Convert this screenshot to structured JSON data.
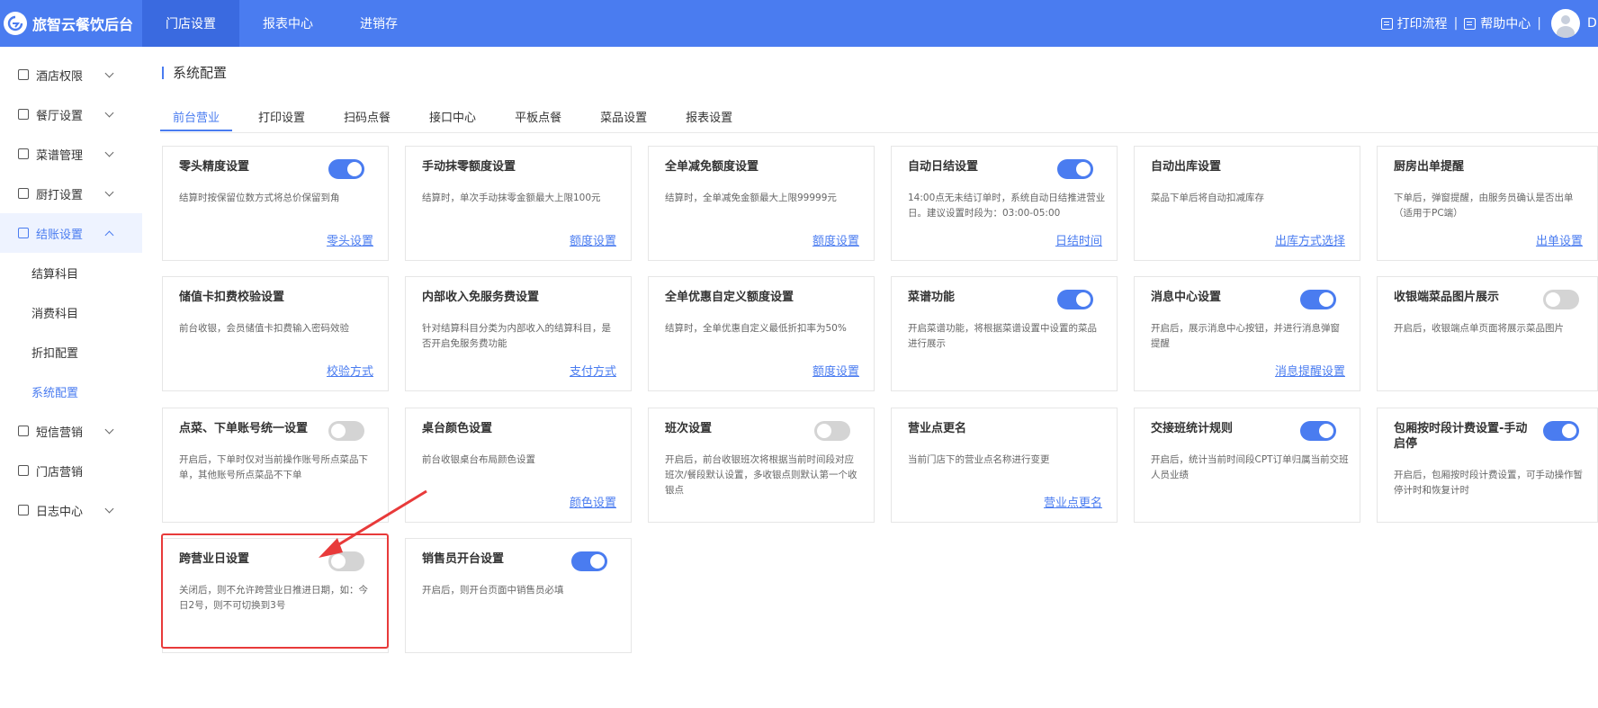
{
  "brand": {
    "title": "旅智云餐饮后台"
  },
  "topnav": [
    "门店设置",
    "报表中心",
    "进销存"
  ],
  "topright": {
    "print_flow": "打印流程",
    "help_center": "帮助中心",
    "separator": "|",
    "user_initial": "D"
  },
  "sidebar": {
    "items": [
      {
        "label": "酒店权限"
      },
      {
        "label": "餐厅设置"
      },
      {
        "label": "菜谱管理"
      },
      {
        "label": "厨打设置"
      },
      {
        "label": "结账设置"
      },
      {
        "label": "短信营销"
      },
      {
        "label": "门店营销"
      },
      {
        "label": "日志中心"
      }
    ],
    "sub_items": [
      "结算科目",
      "消费科目",
      "折扣配置",
      "系统配置"
    ]
  },
  "page": {
    "title": "系统配置"
  },
  "tabs": [
    "前台营业",
    "打印设置",
    "扫码点餐",
    "接口中心",
    "平板点餐",
    "菜品设置",
    "报表设置"
  ],
  "cards": [
    {
      "title": "零头精度设置",
      "desc": "结算时按保留位数方式将总价保留到角",
      "link": "零头设置",
      "toggle": "on"
    },
    {
      "title": "手动抹零额度设置",
      "desc": "结算时，单次手动抹零金额最大上限100元",
      "link": "额度设置"
    },
    {
      "title": "全单减免额度设置",
      "desc": "结算时，全单减免金额最大上限99999元",
      "link": "额度设置"
    },
    {
      "title": "自动日结设置",
      "desc": "14:00点无未结订单时，系统自动日结推进营业日。建议设置时段为：03:00-05:00",
      "link": "日结时间",
      "toggle": "on"
    },
    {
      "title": "自动出库设置",
      "desc": "菜品下单后将自动扣减库存",
      "link": "出库方式选择"
    },
    {
      "title": "厨房出单提醒",
      "desc": "下单后，弹窗提醒，由服务员确认是否出单（适用于PC端）",
      "link": "出单设置"
    },
    {
      "title": "储值卡扣费校验设置",
      "desc": "前台收银，会员储值卡扣费输入密码效验",
      "link": "校验方式"
    },
    {
      "title": "内部收入免服务费设置",
      "desc": "针对结算科目分类为内部收入的结算科目，是否开启免服务费功能",
      "link": "支付方式"
    },
    {
      "title": "全单优惠自定义额度设置",
      "desc": "结算时，全单优惠自定义最低折扣率为50%",
      "link": "额度设置"
    },
    {
      "title": "菜谱功能",
      "desc": "开启菜谱功能，将根据菜谱设置中设置的菜品进行展示",
      "link": "",
      "toggle": "on"
    },
    {
      "title": "消息中心设置",
      "desc": "开启后，展示消息中心按钮，并进行消息弹窗提醒",
      "link": "消息提醒设置",
      "toggle": "on"
    },
    {
      "title": "收银端菜品图片展示",
      "desc": "开启后，收银端点单页面将展示菜品图片",
      "link": "",
      "toggle": "off"
    },
    {
      "title": "点菜、下单账号统一设置",
      "desc": "开启后，下单时仅对当前操作账号所点菜品下单，其他账号所点菜品不下单",
      "link": "",
      "toggle": "off"
    },
    {
      "title": "桌台颜色设置",
      "desc": "前台收银桌台布局颜色设置",
      "link": "颜色设置"
    },
    {
      "title": "班次设置",
      "desc": "开启后，前台收银班次将根据当前时间段对应班次/餐段默认设置，多收银点则默认第一个收银点",
      "link": "",
      "toggle": "off"
    },
    {
      "title": "营业点更名",
      "desc": "当前门店下的营业点名称进行变更",
      "link": "营业点更名"
    },
    {
      "title": "交接班统计规则",
      "desc": "开启后，统计当前时间段CPT订单归属当前交班人员业绩",
      "link": "",
      "toggle": "on"
    },
    {
      "title": "包厢按时段计费设置-手动启停",
      "desc": "开启后，包厢按时段计费设置，可手动操作暂停计时和恢复计时",
      "link": "",
      "toggle": "on"
    },
    {
      "title": "跨营业日设置",
      "desc": "关闭后，则不允许跨营业日推进日期，如：今日2号，则不可切换到3号",
      "link": "",
      "toggle": "off"
    },
    {
      "title": "销售员开台设置",
      "desc": "开启后，则开台页面中销售员必填",
      "link": "",
      "toggle": "on"
    }
  ],
  "colors": {
    "primary": "#4a7cf0",
    "highlight": "#e83a3a"
  }
}
